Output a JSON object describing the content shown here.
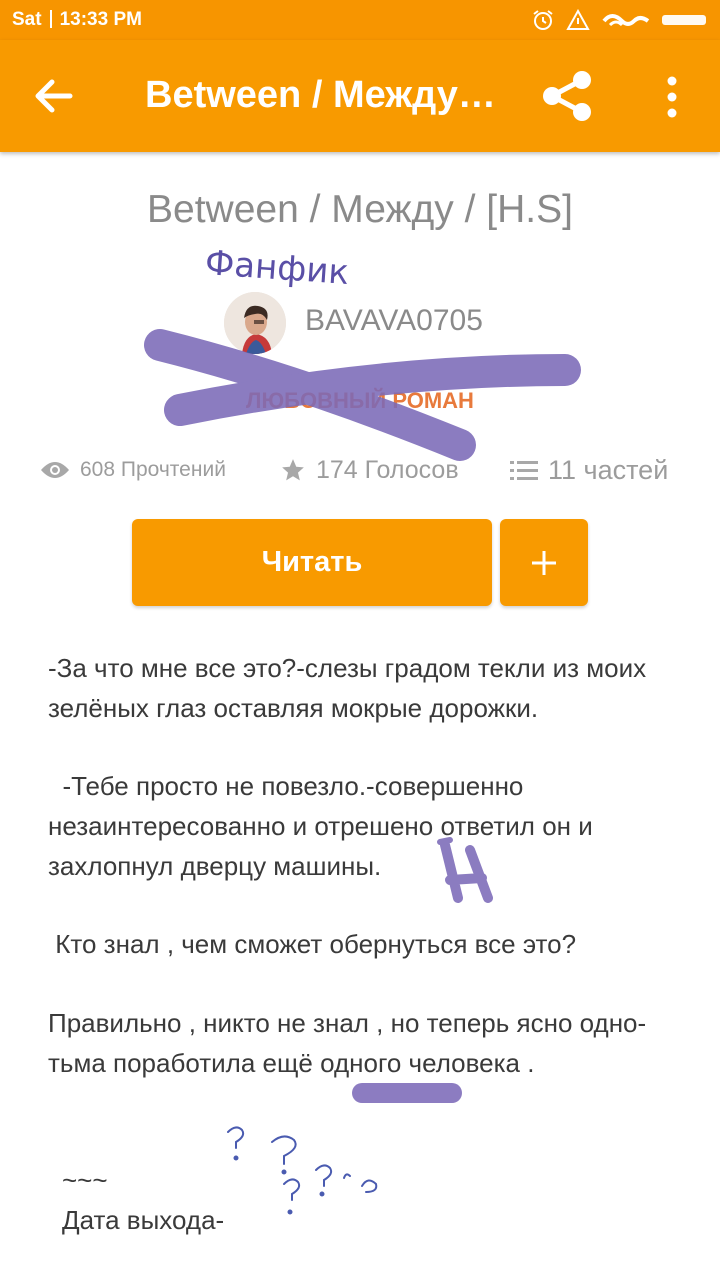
{
  "status_bar": {
    "day": "Sat",
    "time": "13:33 PM",
    "icons": [
      "alarm-icon",
      "signal-icon",
      "wifi-icon",
      "battery-icon"
    ]
  },
  "app_bar": {
    "title": "Between / Между / [H.S]",
    "icons": [
      "back-arrow-icon",
      "share-icon",
      "more-vert-icon"
    ]
  },
  "story": {
    "title": "Between / Между / [H.S]",
    "author": "BAVAVA0705",
    "genre": "ЛЮБОВНЫЙ РОМАН",
    "reads": "608 Прочтений",
    "votes": "174 Голосов",
    "parts": "11 частей"
  },
  "buttons": {
    "read": "Читать",
    "add": "+"
  },
  "description": {
    "p1": "-За что мне все это?-слезы градом текли из моих зелёных глаз оставляя мокрые дорожки.",
    "p2": "  -Тебе просто не повезло.-совершенно незаинтересованно и отрешено ответил он и захлопнул дверцу машины.",
    "p3": " Кто знал , чем сможет обернуться все это?",
    "p4": "Правильно , никто не знал , но теперь ясно одно- тьма поработила ещё одного человека .",
    "p5_line1": "~~~",
    "p5_line2": "Дата выхода-"
  },
  "annotations": {
    "handwritten_label": "Фанфик",
    "marker_color": "#7c6ab8"
  },
  "colors": {
    "accent": "#f89a00",
    "text_gray": "#8a8a8a",
    "genre": "#e87a3c"
  }
}
